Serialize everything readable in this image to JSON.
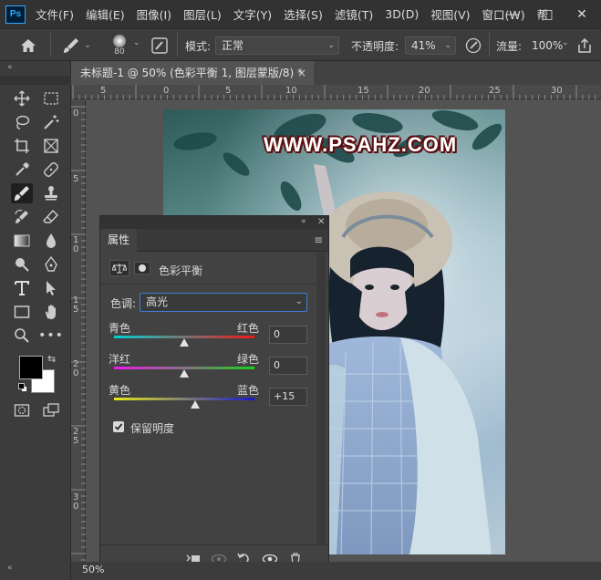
{
  "app": {
    "logo_text": "Ps",
    "menu": [
      "文件(F)",
      "编辑(E)",
      "图像(I)",
      "图层(L)",
      "文字(Y)",
      "选择(S)",
      "滤镜(T)",
      "3D(D)",
      "视图(V)",
      "窗口(W)",
      "帮"
    ],
    "window_controls": [
      "—",
      "□",
      "✕"
    ]
  },
  "options_bar": {
    "brush_size": "80",
    "mode_label": "模式:",
    "mode_value": "正常",
    "opacity_label": "不透明度:",
    "opacity_value": "41%",
    "flow_label": "流量:",
    "flow_value": "100%"
  },
  "document": {
    "tab_title": "未标题-1 @ 50% (色彩平衡 1, 图层蒙版/8) *",
    "close_glyph": "×",
    "zoom": "50%"
  },
  "rulers": {
    "horizontal": [
      "5",
      "0",
      "5",
      "10",
      "15",
      "20",
      "25",
      "30"
    ],
    "vertical": [
      "0",
      "5",
      "1 0",
      "1 5",
      "2 0",
      "2 5",
      "3 0"
    ]
  },
  "canvas": {
    "watermark": "WWW.PSAHZ.COM"
  },
  "properties_panel": {
    "tab_label": "属性",
    "adjustment_title": "色彩平衡",
    "tone_label": "色调:",
    "tone_value": "高光",
    "sliders": [
      {
        "left": "青色",
        "right": "红色",
        "value": "0",
        "level": 0
      },
      {
        "left": "洋红",
        "right": "绿色",
        "value": "0",
        "level": 0
      },
      {
        "left": "黄色",
        "right": "蓝色",
        "value": "+15",
        "level": 15
      }
    ],
    "preserve_label": "保留明度",
    "preserve_checked": true
  },
  "colors": {
    "foreground": "#000000",
    "background": "#ffffff",
    "accent": "#3d7fd4"
  }
}
